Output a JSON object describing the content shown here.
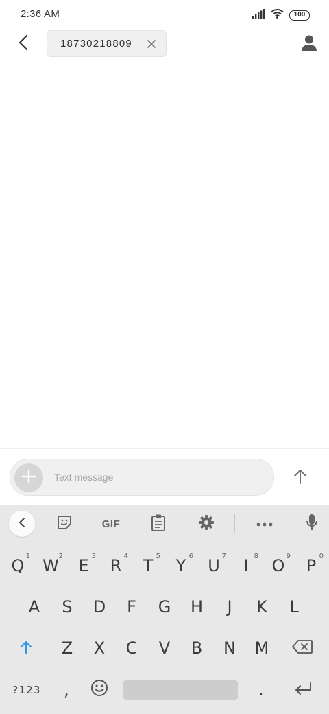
{
  "status_bar": {
    "time": "2:36 AM",
    "battery": "100",
    "icons": [
      "signal-icon",
      "wifi-icon",
      "battery-icon"
    ]
  },
  "header": {
    "back_icon": "back-arrow-icon",
    "recipient": "18730218809",
    "chip_close_icon": "close-icon",
    "contact_icon": "person-icon"
  },
  "compose": {
    "attach_icon": "plus-icon",
    "placeholder": "Text message",
    "value": "",
    "send_icon": "send-arrow-icon"
  },
  "keyboard": {
    "toolbar": {
      "collapse_icon": "chevron-left-icon",
      "sticker_icon": "sticker-icon",
      "gif_label": "GIF",
      "clipboard_icon": "clipboard-icon",
      "settings_icon": "gear-icon",
      "more_icon": "more-horizontal-icon",
      "mic_icon": "mic-icon"
    },
    "row1": [
      {
        "key": "Q",
        "hint": "1"
      },
      {
        "key": "W",
        "hint": "2"
      },
      {
        "key": "E",
        "hint": "3"
      },
      {
        "key": "R",
        "hint": "4"
      },
      {
        "key": "T",
        "hint": "5"
      },
      {
        "key": "Y",
        "hint": "6"
      },
      {
        "key": "U",
        "hint": "7"
      },
      {
        "key": "I",
        "hint": "8"
      },
      {
        "key": "O",
        "hint": "9"
      },
      {
        "key": "P",
        "hint": "0"
      }
    ],
    "row2": [
      "A",
      "S",
      "D",
      "F",
      "G",
      "H",
      "J",
      "K",
      "L"
    ],
    "row3": [
      "Z",
      "X",
      "C",
      "V",
      "B",
      "N",
      "M"
    ],
    "shift_icon": "shift-arrow-icon",
    "backspace_icon": "backspace-icon",
    "symbols_label": "?123",
    "comma": ",",
    "emoji_icon": "emoji-icon",
    "period": ".",
    "enter_icon": "enter-icon",
    "colors": {
      "accent": "#2d9ae6",
      "background": "#e8e8e8",
      "text": "#3c3c3c"
    }
  }
}
